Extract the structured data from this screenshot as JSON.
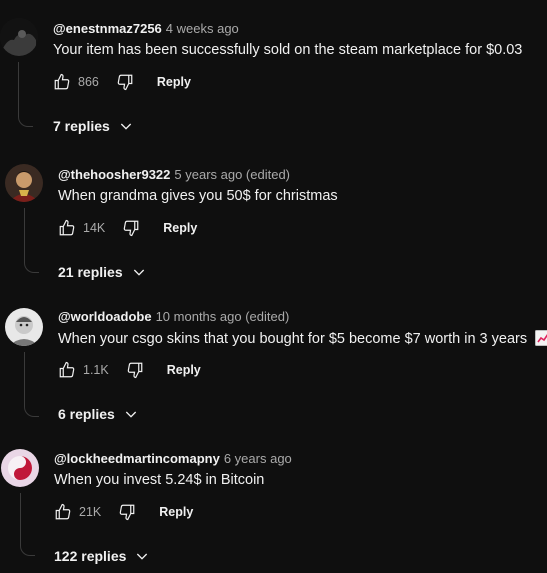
{
  "comments": [
    {
      "handle": "@enestnmaz7256",
      "time": "4 weeks ago",
      "text": "Your item has been successfully sold on the steam marketplace for $0.03",
      "likes": "866",
      "reply_label": "Reply",
      "replies_label": "7 replies"
    },
    {
      "handle": "@thehoosher9322",
      "time": "5 years ago (edited)",
      "text": "When grandma gives you 50$ for christmas",
      "likes": "14K",
      "reply_label": "Reply",
      "replies_label": "21 replies"
    },
    {
      "handle": "@worldoadobe",
      "time": "10 months ago (edited)",
      "text": "When your csgo skins that you bought for $5 become $7 worth in 3 years",
      "likes": "1.1K",
      "reply_label": "Reply",
      "replies_label": "6 replies"
    },
    {
      "handle": "@lockheedmartincomapny",
      "time": "6 years ago",
      "text": "When you invest 5.24$ in Bitcoin",
      "likes": "21K",
      "reply_label": "Reply",
      "replies_label": "122 replies"
    }
  ],
  "icons": {
    "like": "thumbs-up-icon",
    "dislike": "thumbs-down-icon",
    "expand": "chevron-down-icon",
    "emoji": "chart-increasing-icon"
  }
}
